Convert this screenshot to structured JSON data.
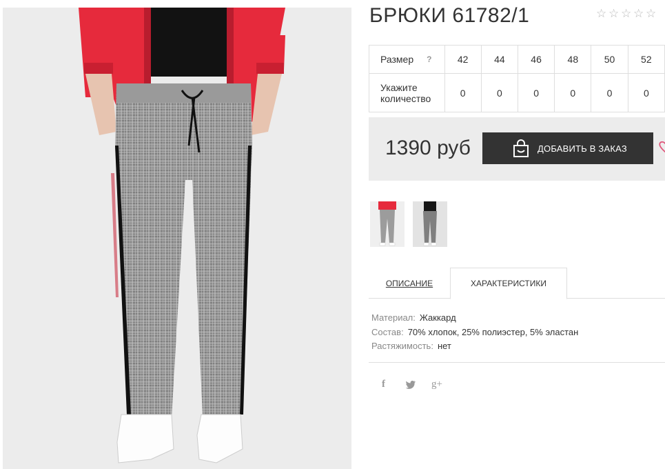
{
  "product": {
    "title": "БРЮКИ 61782/1",
    "rating": 0,
    "stars": [
      "☆",
      "☆",
      "☆",
      "☆",
      "☆"
    ]
  },
  "size_table": {
    "size_label": "Размер",
    "help_mark": "?",
    "qty_label": "Укажите количество",
    "sizes": [
      "42",
      "44",
      "46",
      "48",
      "50",
      "52"
    ],
    "quantities": [
      "0",
      "0",
      "0",
      "0",
      "0",
      "0"
    ]
  },
  "price": {
    "value": "1390 руб",
    "add_button_label": "ДОБАВИТЬ В ЗАКАЗ"
  },
  "tabs": [
    {
      "label": "ОПИСАНИЕ"
    },
    {
      "label": "ХАРАКТЕРИСТИКИ"
    }
  ],
  "characteristics": [
    {
      "key": "Материал:",
      "value": "Жаккард"
    },
    {
      "key": "Состав:",
      "value": "70% хлопок, 25% полиэстер, 5% эластан"
    },
    {
      "key": "Растяжимость:",
      "value": "нет"
    }
  ],
  "social": {
    "facebook": "f",
    "twitter": "🐦",
    "google_plus": "g+"
  },
  "colors": {
    "button_bg": "#333333",
    "price_block_bg": "#ececec",
    "jacket_red": "#e62a3c",
    "border": "#dedede",
    "heart": "#e0557a"
  },
  "icons": {
    "bag": "shopping-bag-icon",
    "heart": "heart-icon"
  }
}
